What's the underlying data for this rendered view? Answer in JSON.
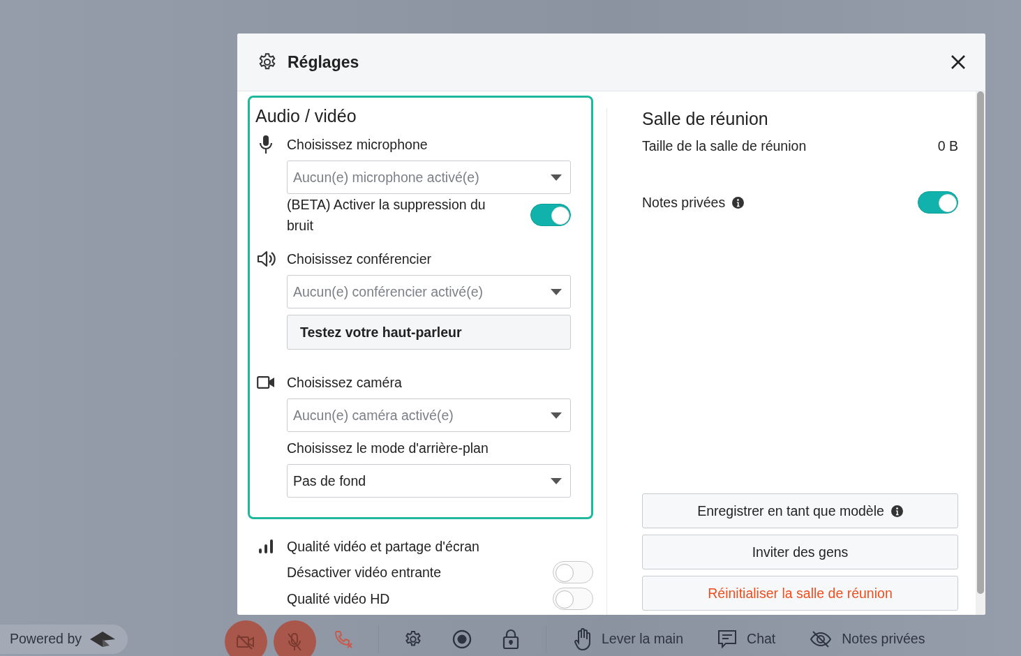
{
  "window": {
    "title": "Réglages"
  },
  "audio_video": {
    "title": "Audio / vidéo",
    "microphone": {
      "label": "Choisissez microphone",
      "placeholder": "Aucun(e) microphone activé(e)"
    },
    "noise_suppression": {
      "label": "(BETA) Activer la suppression du bruit",
      "on": true
    },
    "speaker": {
      "label": "Choisissez conférencier",
      "placeholder": "Aucun(e) conférencier activé(e)",
      "test_button": "Testez votre haut-parleur"
    },
    "camera": {
      "label": "Choisissez caméra",
      "placeholder": "Aucun(e) caméra activé(e)"
    },
    "background": {
      "label": "Choisissez le mode d'arrière-plan",
      "value": "Pas de fond"
    }
  },
  "video_quality": {
    "title": "Qualité vidéo et partage d'écran",
    "toggles": [
      {
        "label": "Désactiver vidéo entrante",
        "on": false
      },
      {
        "label": "Qualité vidéo HD",
        "on": false
      }
    ]
  },
  "room": {
    "title": "Salle de réunion",
    "size_label": "Taille de la salle de réunion",
    "size_value": "0 B",
    "private_notes": {
      "label": "Notes privées",
      "on": true
    },
    "buttons": [
      {
        "label": "Enregistrer en tant que modèle",
        "kind": "default",
        "info": true
      },
      {
        "label": "Inviter des gens",
        "kind": "default",
        "info": false
      },
      {
        "label": "Réinitialiser la salle de réunion",
        "kind": "danger",
        "info": false
      }
    ]
  },
  "toolbar": {
    "powered_by": "Powered by",
    "items": [
      {
        "kind": "camera-off",
        "active": true
      },
      {
        "kind": "mic-off",
        "active": true
      },
      {
        "kind": "hangup",
        "active": false
      },
      {
        "kind": "divider"
      },
      {
        "kind": "settings",
        "active": false
      },
      {
        "kind": "record",
        "active": false
      },
      {
        "kind": "lock",
        "active": false
      },
      {
        "kind": "divider"
      },
      {
        "kind": "hand",
        "active": false,
        "label": "Lever la main"
      },
      {
        "kind": "chat",
        "active": false,
        "label": "Chat"
      },
      {
        "kind": "eye-off",
        "active": false,
        "label": "Notes privées"
      }
    ]
  }
}
